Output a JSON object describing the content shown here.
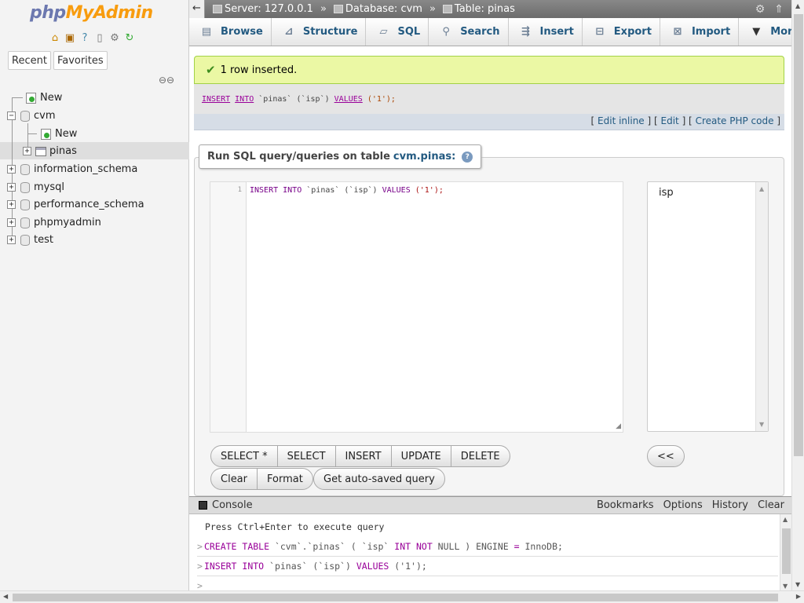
{
  "logo": {
    "php": "php",
    "ma": "MyAdmin"
  },
  "nav": {
    "tabs": [
      "Recent",
      "Favorites"
    ],
    "tree": {
      "new_top": "New",
      "db_cvm": "cvm",
      "new_cvm": "New",
      "table_pinas": "pinas",
      "dbs": [
        "information_schema",
        "mysql",
        "performance_schema",
        "phpmyadmin",
        "test"
      ]
    }
  },
  "breadcrumb": {
    "server": "Server: 127.0.0.1",
    "database": "Database: cvm",
    "table": "Table: pinas",
    "sep": "»"
  },
  "tabs": [
    "Browse",
    "Structure",
    "SQL",
    "Search",
    "Insert",
    "Export",
    "Import",
    "More"
  ],
  "message": {
    "success": "1 row inserted."
  },
  "executed_sql": {
    "kw1": "INSERT",
    "kw2": "INTO",
    "tbl": "`pinas`",
    "col": "(`isp`)",
    "kw3": "VALUES",
    "val": "('1');"
  },
  "links": {
    "edit_inline": "Edit inline",
    "edit": "Edit",
    "create_php": "Create PHP code"
  },
  "query": {
    "legend": "Run SQL query/queries on table",
    "table_ref": "cvm.pinas:",
    "line_no": "1",
    "code_kw": "INSERT INTO",
    "code_tbl": " `pinas` (`isp`) ",
    "code_kw2": "VALUES",
    "code_val": " ('1');",
    "columns": [
      "isp"
    ],
    "buttons": [
      "SELECT *",
      "SELECT",
      "INSERT",
      "UPDATE",
      "DELETE"
    ],
    "buttons2": [
      "Clear",
      "Format"
    ],
    "autosave": "Get auto-saved query",
    "insert_col": "<<"
  },
  "console": {
    "title": "Console",
    "options": [
      "Bookmarks",
      "Options",
      "History",
      "Clear"
    ],
    "hint": "Press Ctrl+Enter to execute query",
    "prompt": ">",
    "line1_a": "CREATE TABLE",
    "line1_b": " `cvm`.`pinas` ( `isp` ",
    "line1_c": "INT NOT",
    "line1_d": " NULL ) ENGINE ",
    "line1_e": "=",
    "line1_f": " InnoDB;",
    "line2_a": "INSERT INTO",
    "line2_b": " `pinas` (`isp`) ",
    "line2_c": "VALUES",
    "line2_d": " ('1');"
  },
  "colors": {
    "accent": "#235a81",
    "success_bg": "#ebf8a4",
    "keyword": "#990099"
  }
}
